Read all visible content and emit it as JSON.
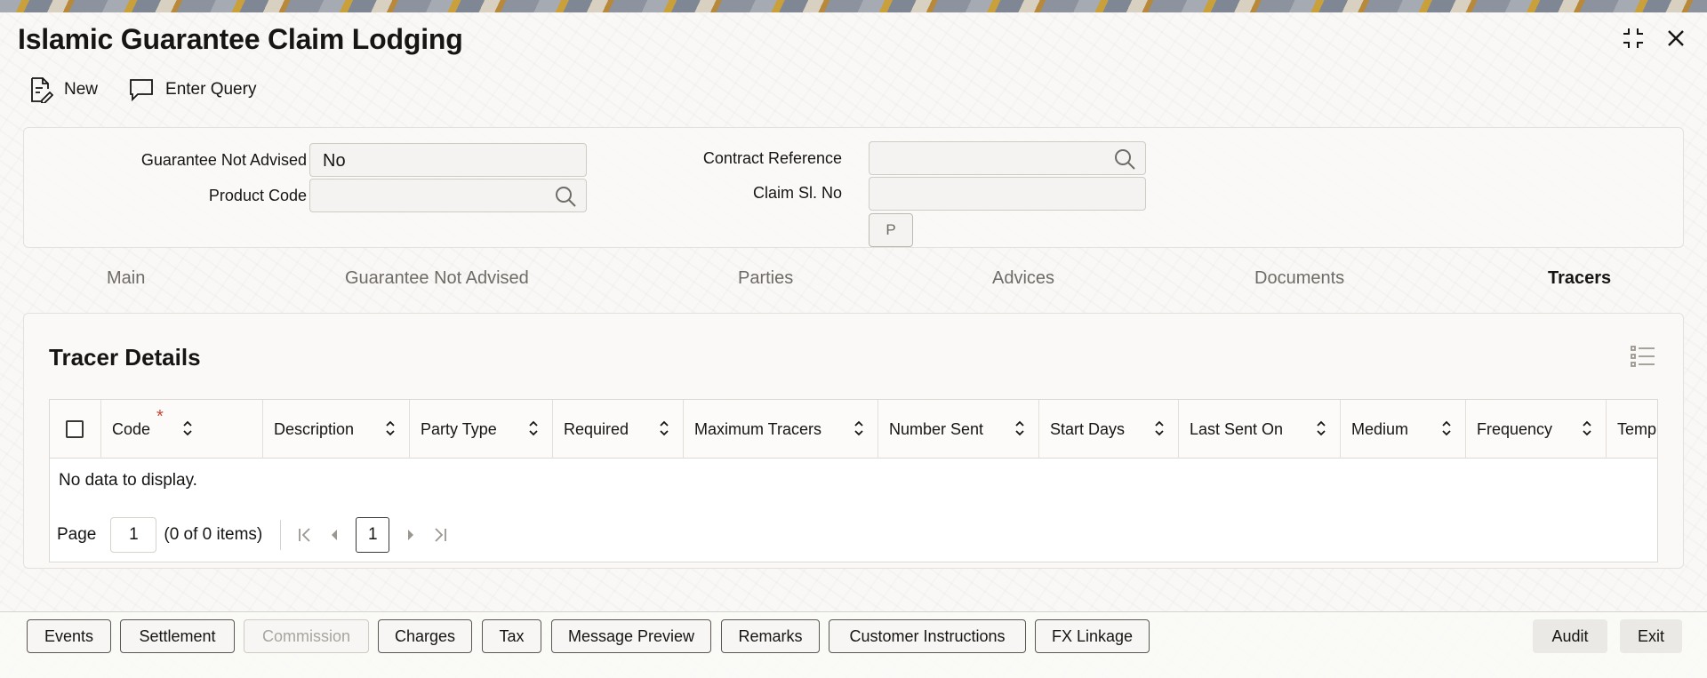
{
  "window": {
    "title": "Islamic Guarantee Claim Lodging"
  },
  "toolbar": {
    "new_label": "New",
    "enter_query_label": "Enter Query"
  },
  "form": {
    "guarantee_not_advised": {
      "label": "Guarantee Not Advised",
      "value": "No"
    },
    "product_code": {
      "label": "Product Code",
      "value": ""
    },
    "contract_reference": {
      "label": "Contract Reference",
      "value": ""
    },
    "claim_sl_no": {
      "label": "Claim Sl. No",
      "value": ""
    },
    "p_button": "P"
  },
  "tabs": [
    {
      "label": "Main",
      "active": false
    },
    {
      "label": "Guarantee Not Advised",
      "active": false
    },
    {
      "label": "Parties",
      "active": false
    },
    {
      "label": "Advices",
      "active": false
    },
    {
      "label": "Documents",
      "active": false
    },
    {
      "label": "Tracers",
      "active": true
    }
  ],
  "tracer_details": {
    "title": "Tracer Details",
    "columns": [
      {
        "label": "Code",
        "required": true
      },
      {
        "label": "Description"
      },
      {
        "label": "Party Type"
      },
      {
        "label": "Required"
      },
      {
        "label": "Maximum Tracers"
      },
      {
        "label": "Number Sent"
      },
      {
        "label": "Start Days"
      },
      {
        "label": "Last Sent On"
      },
      {
        "label": "Medium"
      },
      {
        "label": "Frequency"
      },
      {
        "label": "Temp"
      }
    ],
    "required_marker": "*",
    "empty_text": "No data to display.",
    "pager": {
      "page_label": "Page",
      "page_value": "1",
      "count_text": "(0 of 0 items)",
      "current_page": "1"
    }
  },
  "footer": {
    "buttons": [
      {
        "label": "Events",
        "enabled": true
      },
      {
        "label": "Settlement",
        "enabled": true
      },
      {
        "label": "Commission",
        "enabled": false
      },
      {
        "label": "Charges",
        "enabled": true
      },
      {
        "label": "Tax",
        "enabled": true
      },
      {
        "label": "Message Preview",
        "enabled": true
      },
      {
        "label": "Remarks",
        "enabled": true
      },
      {
        "label": "Customer Instructions",
        "enabled": true
      },
      {
        "label": "FX Linkage",
        "enabled": true
      }
    ],
    "audit_label": "Audit",
    "exit_label": "Exit"
  },
  "colors": {
    "text": "#161513",
    "muted_text": "#6f6b66",
    "required_star": "#c74634",
    "border": "#dcd9d4"
  }
}
